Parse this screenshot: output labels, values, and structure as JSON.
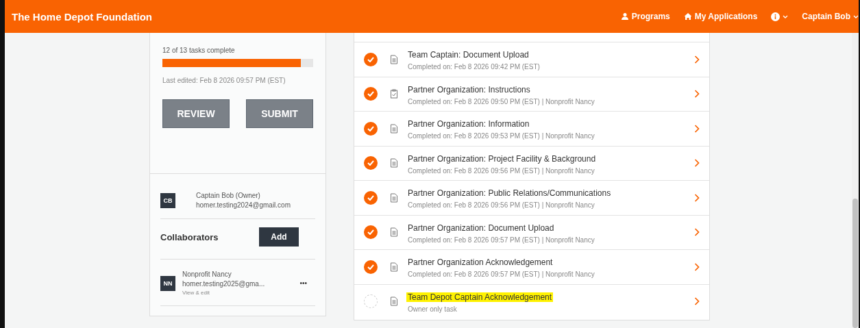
{
  "header": {
    "brand": "The Home Depot Foundation",
    "nav": [
      {
        "kind": "programs",
        "label": "Programs"
      },
      {
        "kind": "applications",
        "label": "My Applications"
      },
      {
        "kind": "info"
      },
      {
        "kind": "user",
        "label": "Captain Bob"
      }
    ]
  },
  "progress": {
    "summary": "12 of 13 tasks complete",
    "level": 0.92,
    "last_edited": "Last edited: Feb 8 2026 09:57 PM (EST)"
  },
  "actions": [
    {
      "label": "REVIEW",
      "disabled": true
    },
    {
      "label": "SUBMIT",
      "disabled": true
    }
  ],
  "owner": {
    "initials": "CB",
    "name": "Captain Bob (Owner)",
    "email": "homer.testing2024@gmail.com"
  },
  "collaborators": {
    "title": "Collaborators",
    "add": "Add",
    "people": [
      {
        "initials": "NN",
        "name": "Nonprofit Nancy",
        "email": "homer.testing2025@gma...",
        "role": "View & edit",
        "more": "•••"
      }
    ]
  },
  "tasks": [
    {
      "title": "Team Captain: Document Upload",
      "detail": "Completed on: Feb 8 2026 09:42 PM (EST)",
      "completed": true,
      "kind": "document",
      "highlighted": false
    },
    {
      "title": "Partner Organization: Instructions",
      "detail": "Completed on: Feb 8 2026 09:50 PM (EST) | Nonprofit Nancy",
      "completed": true,
      "kind": "checklist",
      "highlighted": false
    },
    {
      "title": "Partner Organization: Information",
      "detail": "Completed on: Feb 8 2026 09:53 PM (EST) | Nonprofit Nancy",
      "completed": true,
      "kind": "document",
      "highlighted": false
    },
    {
      "title": "Partner Organization: Project Facility & Background",
      "detail": "Completed on: Feb 8 2026 09:56 PM (EST) | Nonprofit Nancy",
      "completed": true,
      "kind": "document",
      "highlighted": false
    },
    {
      "title": "Partner Organization: Public Relations/Communications",
      "detail": "Completed on: Feb 8 2026 09:56 PM (EST) | Nonprofit Nancy",
      "completed": true,
      "kind": "document",
      "highlighted": false
    },
    {
      "title": "Partner Organization: Document Upload",
      "detail": "Completed on: Feb 8 2026 09:57 PM (EST) | Nonprofit Nancy",
      "completed": true,
      "kind": "document",
      "highlighted": false
    },
    {
      "title": "Partner Organization Acknowledgement",
      "detail": "Completed on: Feb 8 2026 09:57 PM (EST) | Nonprofit Nancy",
      "completed": true,
      "kind": "document",
      "highlighted": false
    },
    {
      "title": "Team Depot Captain Acknowledgement",
      "detail": "Owner only task",
      "completed": false,
      "kind": "document",
      "highlighted": true
    }
  ]
}
